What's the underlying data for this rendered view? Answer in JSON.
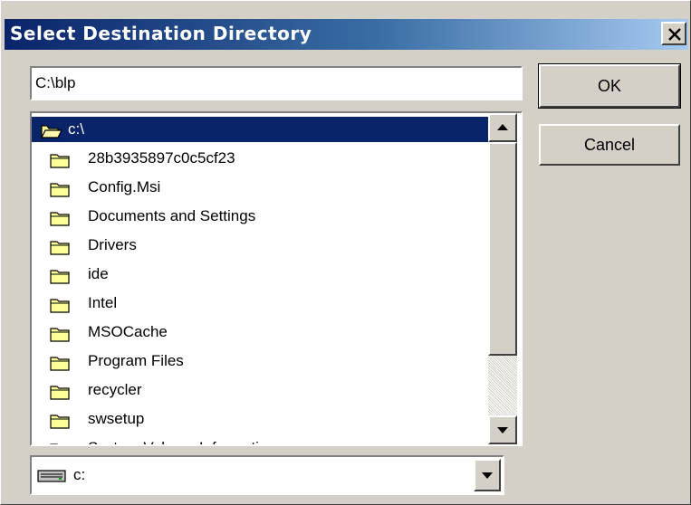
{
  "window": {
    "title": "Select Destination Directory",
    "close_glyph": "×"
  },
  "path_input": {
    "value": "C:\\blp"
  },
  "buttons": {
    "ok_label": "OK",
    "cancel_label": "Cancel"
  },
  "folder_list": {
    "selected": {
      "label": "c:\\",
      "icon": "open-folder-icon"
    },
    "items": [
      {
        "label": "28b3935897c0c5cf23",
        "icon": "folder-icon"
      },
      {
        "label": "Config.Msi",
        "icon": "folder-icon"
      },
      {
        "label": "Documents and Settings",
        "icon": "folder-icon"
      },
      {
        "label": "Drivers",
        "icon": "folder-icon"
      },
      {
        "label": "ide",
        "icon": "folder-icon"
      },
      {
        "label": "Intel",
        "icon": "folder-icon"
      },
      {
        "label": "MSOCache",
        "icon": "folder-icon"
      },
      {
        "label": "Program Files",
        "icon": "folder-icon"
      },
      {
        "label": "recycler",
        "icon": "folder-icon"
      },
      {
        "label": "swsetup",
        "icon": "folder-icon"
      },
      {
        "label": "System Volume Information",
        "icon": "folder-icon"
      }
    ]
  },
  "drive_select": {
    "value": "c:",
    "icon": "drive-icon"
  },
  "colors": {
    "dialog_bg": "#d4d0c8",
    "selection_bg": "#0a246a",
    "title_gradient_start": "#0a246a",
    "title_gradient_end": "#a6caf0",
    "folder_fill": "#ffff99"
  }
}
